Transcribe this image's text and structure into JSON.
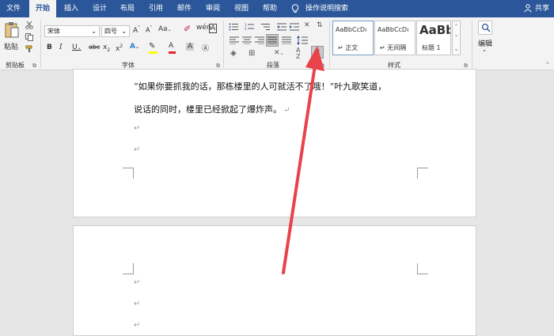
{
  "tabs": [
    {
      "label": "文件",
      "active": false
    },
    {
      "label": "开始",
      "active": true
    },
    {
      "label": "插入",
      "active": false
    },
    {
      "label": "设计",
      "active": false
    },
    {
      "label": "布局",
      "active": false
    },
    {
      "label": "引用",
      "active": false
    },
    {
      "label": "邮件",
      "active": false
    },
    {
      "label": "审阅",
      "active": false
    },
    {
      "label": "视图",
      "active": false
    },
    {
      "label": "帮助",
      "active": false
    }
  ],
  "search_tab": {
    "label": "操作说明搜索",
    "icon": "lightbulb-icon"
  },
  "share": {
    "label": "共享",
    "icon": "person-icon"
  },
  "ribbon": {
    "clipboard": {
      "paste_label": "粘贴",
      "group_label": "剪贴板"
    },
    "font": {
      "font_name": "宋体",
      "font_size": "四号",
      "group_label": "字体"
    },
    "paragraph": {
      "group_label": "段落"
    },
    "styles": {
      "group_label": "样式",
      "cards": [
        {
          "preview": "AaBbCcDı",
          "name": "↵ 正文"
        },
        {
          "preview": "AaBbCcDı",
          "name": "↵ 无间隔"
        },
        {
          "preview": "AaBb",
          "name": "标题 1"
        }
      ]
    },
    "editing": {
      "label": "编辑"
    }
  },
  "document": {
    "line1": "“如果你要抓我的话，那栋楼里的人可就活不了哦！”叶九歌笑道，",
    "line2": "说话的同时，楼里已经掀起了爆炸声。",
    "mark": "↵"
  },
  "colors": {
    "brand": "#2b579a",
    "arrow": "#e8424a"
  }
}
